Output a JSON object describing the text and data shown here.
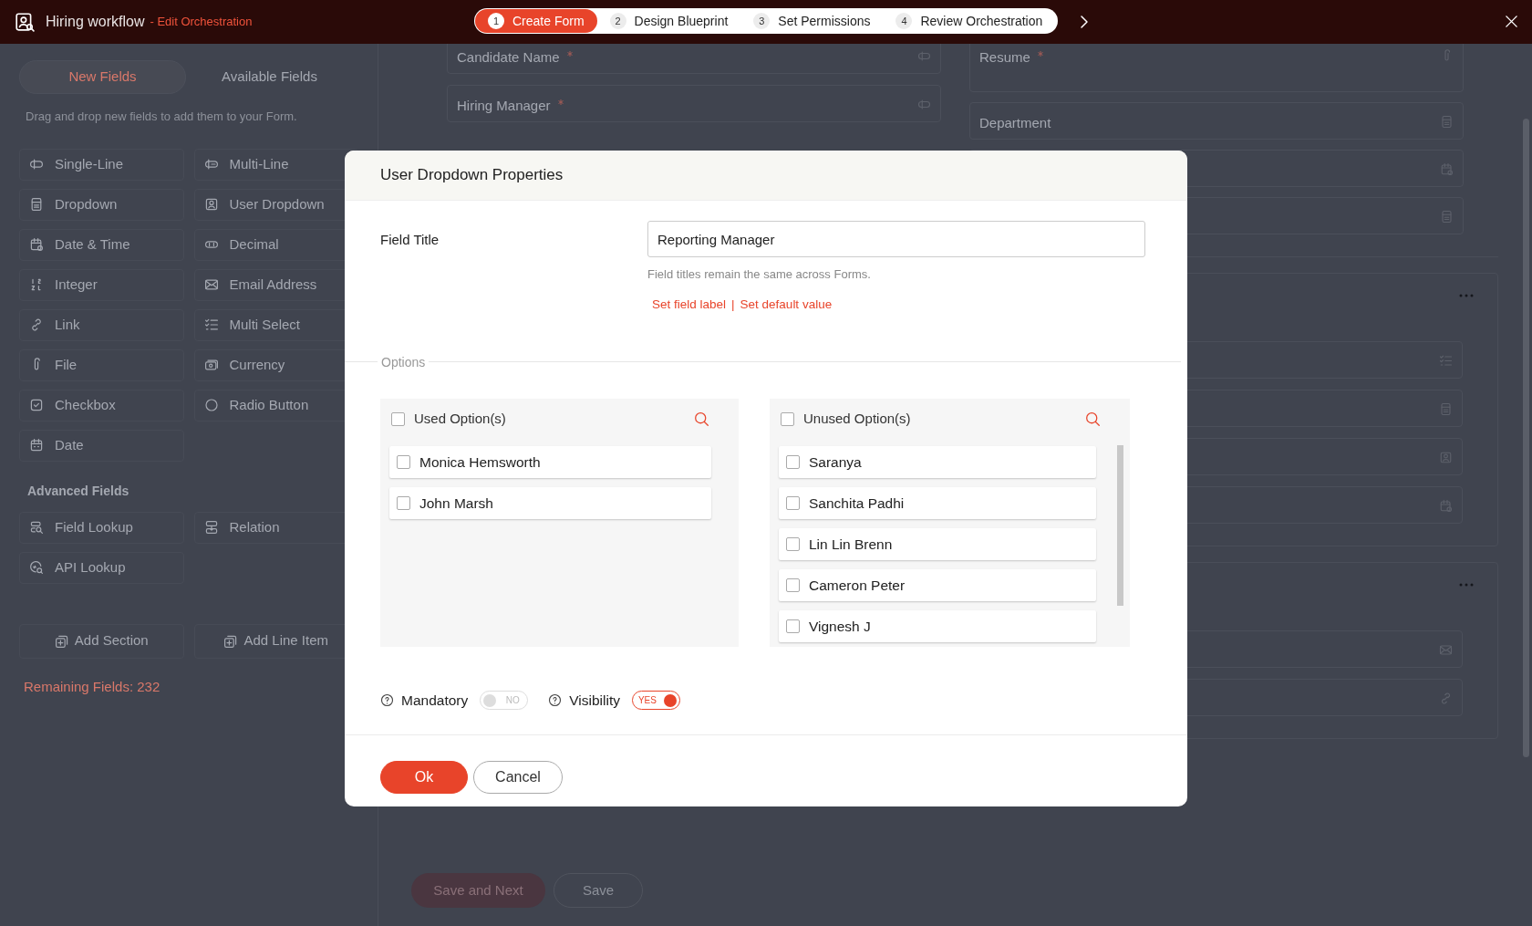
{
  "app": {
    "title": "Hiring workflow",
    "subtitle": "- Edit Orchestration"
  },
  "steps": [
    {
      "number": "1",
      "label": "Create Form",
      "selected": true
    },
    {
      "number": "2",
      "label": "Design Blueprint",
      "selected": false
    },
    {
      "number": "3",
      "label": "Set Permissions",
      "selected": false
    },
    {
      "number": "4",
      "label": "Review Orchestration",
      "selected": false
    }
  ],
  "left_panel": {
    "tabs": [
      {
        "label": "New Fields",
        "selected": true
      },
      {
        "label": "Available Fields",
        "selected": false
      }
    ],
    "hint": "Drag and drop new fields to add them to your Form.",
    "fields": [
      {
        "label": "Single-Line",
        "kind": "single-line"
      },
      {
        "label": "Multi-Line",
        "kind": "multi-line"
      },
      {
        "label": "Dropdown",
        "kind": "dropdown"
      },
      {
        "label": "User Dropdown",
        "kind": "user-dropdown"
      },
      {
        "label": "Date & Time",
        "kind": "date-time"
      },
      {
        "label": "Decimal",
        "kind": "decimal"
      },
      {
        "label": "Integer",
        "kind": "integer"
      },
      {
        "label": "Email Address",
        "kind": "email"
      },
      {
        "label": "Link",
        "kind": "link"
      },
      {
        "label": "Multi Select",
        "kind": "multi-select"
      },
      {
        "label": "File",
        "kind": "file"
      },
      {
        "label": "Currency",
        "kind": "currency"
      },
      {
        "label": "Checkbox",
        "kind": "checkbox"
      },
      {
        "label": "Radio Button",
        "kind": "radio"
      },
      {
        "label": "Date",
        "kind": "date"
      }
    ],
    "advanced_heading": "Advanced Fields",
    "advanced_fields": [
      {
        "label": "Field Lookup",
        "kind": "field-lookup"
      },
      {
        "label": "Relation",
        "kind": "relation"
      },
      {
        "label": "API Lookup",
        "kind": "api-lookup"
      }
    ],
    "actions": [
      "Add Section",
      "Add Line Item"
    ],
    "remaining": "Remaining Fields: 232"
  },
  "form": {
    "left_fields": [
      {
        "label": "Candidate Name",
        "required": true,
        "kind": "single-line"
      },
      {
        "label": "Hiring Manager",
        "required": true,
        "kind": "single-line"
      }
    ],
    "right_fields": [
      {
        "label": "Resume",
        "required": true,
        "kind": "file"
      },
      {
        "label": "Department",
        "required": false,
        "kind": "dropdown"
      },
      {
        "kind": "date-time"
      },
      {
        "kind": "dropdown"
      }
    ],
    "sections": [
      {
        "menu": true,
        "fields": [
          {
            "kind": "multi-select"
          },
          {
            "kind": "dropdown"
          },
          {
            "kind": "user-dropdown"
          },
          {
            "kind": "date-time"
          }
        ]
      },
      {
        "menu": true,
        "fields": [
          {
            "kind": "email"
          },
          {
            "kind": "link"
          }
        ]
      }
    ],
    "buttons": [
      "Save and Next",
      "Save"
    ]
  },
  "dialog": {
    "title": "User Dropdown Properties",
    "field_title": {
      "label": "Field Title",
      "value": "Reporting Manager",
      "help": "Field titles remain the same across Forms.",
      "links": [
        "Set field label",
        "Set default value"
      ],
      "separator": "|"
    },
    "options_legend": "Options",
    "used": {
      "label": "Used Option(s)",
      "checked": false,
      "items": [
        {
          "label": "Monica Hemsworth",
          "checked": false
        },
        {
          "label": "John Marsh",
          "checked": false
        }
      ]
    },
    "unused": {
      "label": "Unused Option(s)",
      "checked": false,
      "items": [
        {
          "label": "Saranya",
          "checked": false
        },
        {
          "label": "Sanchita Padhi",
          "checked": false
        },
        {
          "label": "Lin Lin Brenn",
          "checked": false
        },
        {
          "label": "Cameron Peter",
          "checked": false
        },
        {
          "label": "Vignesh J",
          "checked": false
        }
      ]
    },
    "toggles": [
      {
        "label": "Mandatory",
        "on": false,
        "text": "NO"
      },
      {
        "label": "Visibility",
        "on": true,
        "text": "YES"
      }
    ],
    "buttons": [
      {
        "label": "Ok",
        "kind": "primary"
      },
      {
        "label": "Cancel",
        "kind": "secondary"
      }
    ]
  }
}
